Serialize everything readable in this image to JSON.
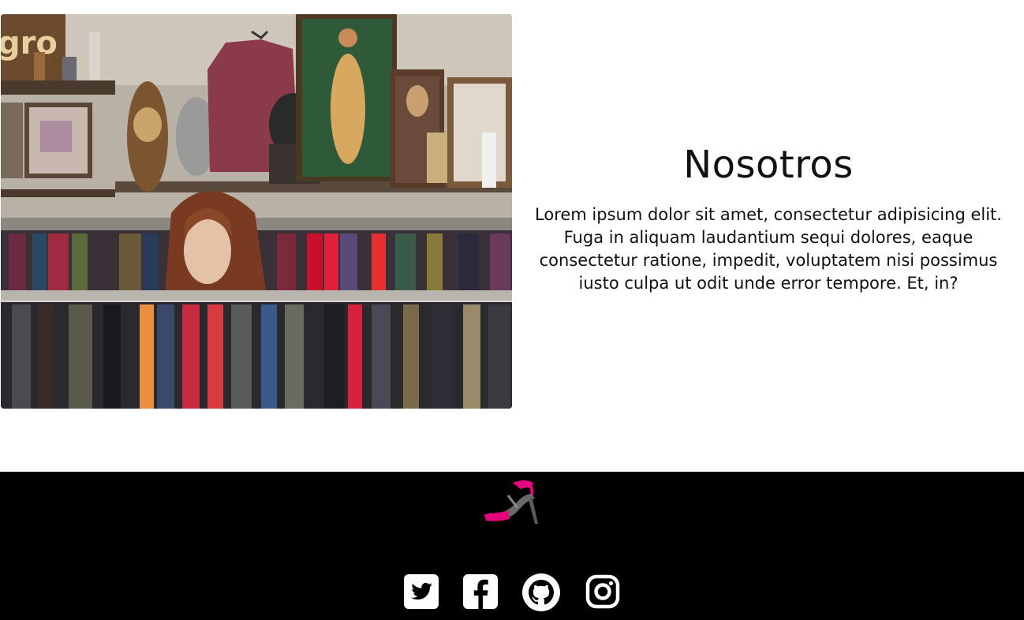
{
  "about": {
    "title": "Nosotros",
    "body": "Lorem ipsum dolor sit amet, consectetur adipisicing elit. Fuga in aliquam laudantium sequi dolores, eaque consectetur ratione, impedit, voluptatem nisi possimus iusto culpa ut odit unde error tempore. Et, in?",
    "photo_sign": "gro"
  },
  "footer": {
    "logo_icon": "high-heel-shoe-icon",
    "brand_color": "#e6007e",
    "background": "#000000",
    "socials": [
      {
        "name": "twitter",
        "icon": "twitter-icon"
      },
      {
        "name": "facebook",
        "icon": "facebook-icon"
      },
      {
        "name": "github",
        "icon": "github-icon"
      },
      {
        "name": "instagram",
        "icon": "instagram-icon"
      }
    ]
  }
}
